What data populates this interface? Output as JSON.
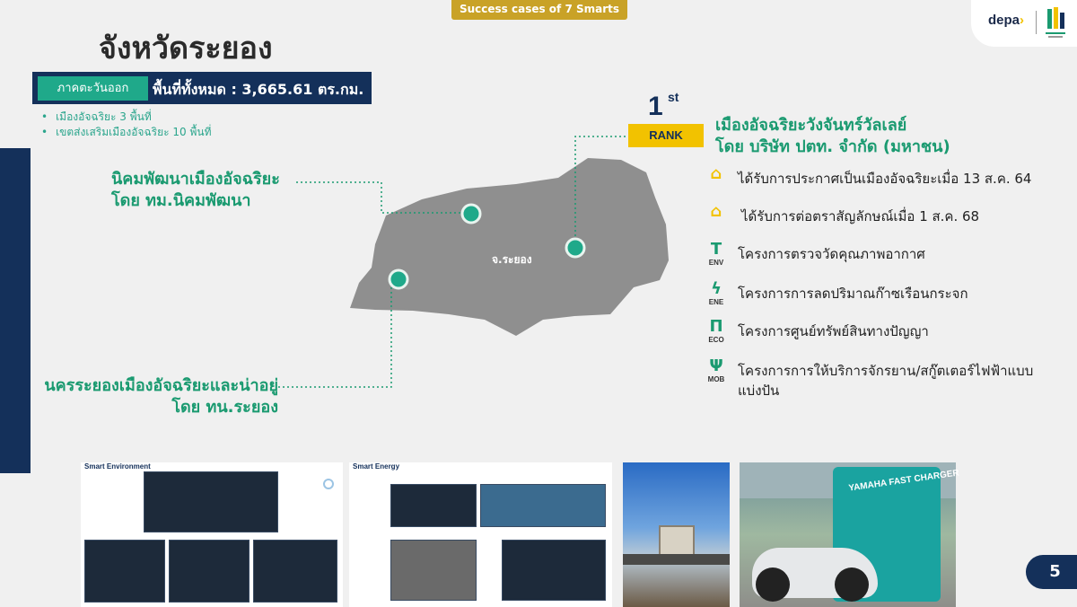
{
  "header": {
    "tag": "Success cases of 7 Smarts",
    "depa_logo": "depa",
    "title": "จังหวัดระยอง"
  },
  "region": {
    "name": "ภาคตะวันออก",
    "area": "พื้นที่ทั้งหมด : 3,665.61 ตร.กม."
  },
  "bullets": [
    "เมืองอัจฉริยะ 3 พื้นที่",
    "เขตส่งเสริมเมืองอัจฉริยะ 10 พื้นที่"
  ],
  "map": {
    "province_label": "จ.ระยอง",
    "callout_1": {
      "line1": "นิคมพัฒนาเมืองอัจฉริยะ",
      "line2": "โดย ทม.นิคมพัฒนา"
    },
    "callout_2": {
      "line1": "นครระยองเมืองอัจฉริยะและน่าอยู่",
      "line2": "โดย ทน.ระยอง"
    }
  },
  "rank": {
    "number": "1",
    "suffix": "st",
    "label": "RANK",
    "city_line1": "เมืองอัจฉริยะวังจันทร์วัลเลย์",
    "city_line2": "โดย บริษัท ปตท. จำกัด (มหาชน)"
  },
  "items": [
    {
      "icon": "smart-city-icon",
      "code": "",
      "text": "ได้รับการประกาศเป็นเมืองอัจฉริยะเมื่อ 13 ส.ค. 64"
    },
    {
      "icon": "smart-city-icon",
      "code": "",
      "text": "ได้รับการต่อตราสัญลักษณ์เมื่อ 1 ส.ค. 68"
    },
    {
      "icon": "env-icon",
      "code": "ENV",
      "text": "โครงการตรวจวัดคุณภาพอากาศ"
    },
    {
      "icon": "ene-icon",
      "code": "ENE",
      "text": "โครงการการลดปริมาณก๊าซเรือนกระจก"
    },
    {
      "icon": "eco-icon",
      "code": "ECO",
      "text": "โครงการศูนย์ทรัพย์สินทางปัญญา"
    },
    {
      "icon": "mob-icon",
      "code": "MOB",
      "text": "โครงการการให้บริการจักรยาน/สกู๊ตเตอร์ไฟฟ้าแบบแบ่งปัน"
    }
  ],
  "thumbnails": {
    "env_title": "Smart Environment",
    "energy_title": "Smart Energy",
    "charger_text": "YAMAHA FAST CHARGER"
  },
  "colors": {
    "navy": "#14305a",
    "green": "#1a9a70",
    "teal": "#1fa98a",
    "gold": "#f2c200",
    "map_gray": "#8f8f8f"
  },
  "page": {
    "number": "5"
  }
}
